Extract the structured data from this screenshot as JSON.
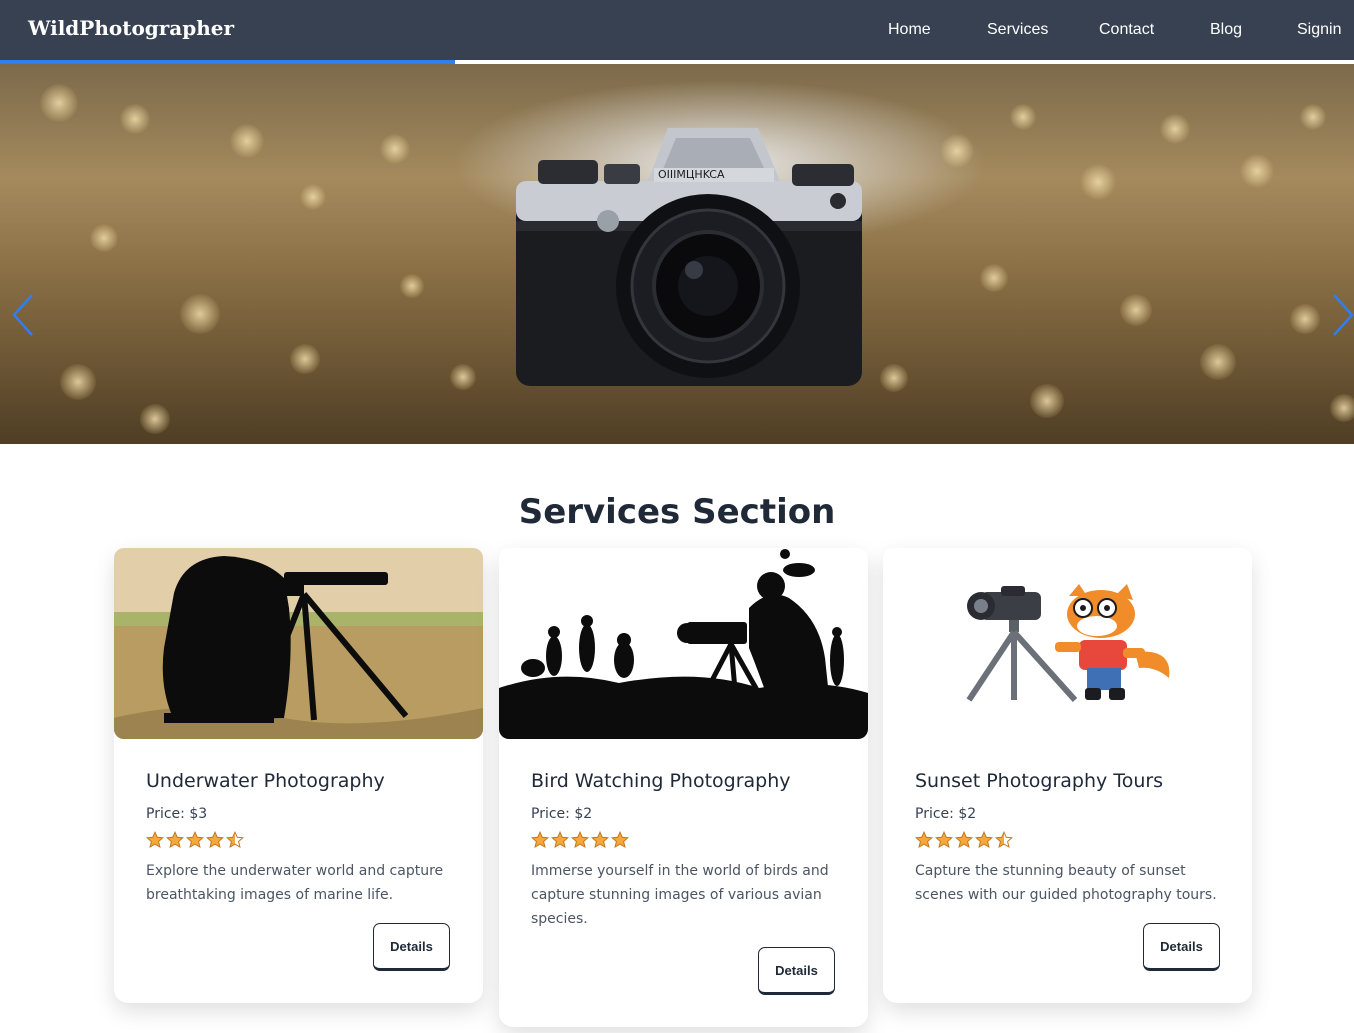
{
  "navbar": {
    "brand": "WildPhotographer",
    "links": [
      "Home",
      "Services",
      "Contact",
      "Blog",
      "Signin"
    ],
    "scroll_progress": 0.336
  },
  "hero": {
    "prev_icon": "chevron-left-icon",
    "next_icon": "chevron-right-icon",
    "camera_label": "ОIIIMЦHKCA"
  },
  "services": {
    "title": "Services Section",
    "cards": [
      {
        "title": "Underwater Photography",
        "price": "Price: $3",
        "rating": 4.5,
        "description": "Explore the underwater world and capture breathtaking images of marine life.",
        "button": "Details"
      },
      {
        "title": "Bird Watching Photography",
        "price": "Price: $2",
        "rating": 5,
        "description": "Immerse yourself in the world of birds and capture stunning images of various avian species.",
        "button": "Details"
      },
      {
        "title": "Sunset Photography Tours",
        "price": "Price: $2",
        "rating": 4.5,
        "description": "Capture the stunning beauty of sunset scenes with our guided photography tours.",
        "button": "Details"
      }
    ]
  },
  "colors": {
    "navbar_bg": "#374151",
    "accent": "#2f7ef2",
    "star": "#f4a93a"
  }
}
